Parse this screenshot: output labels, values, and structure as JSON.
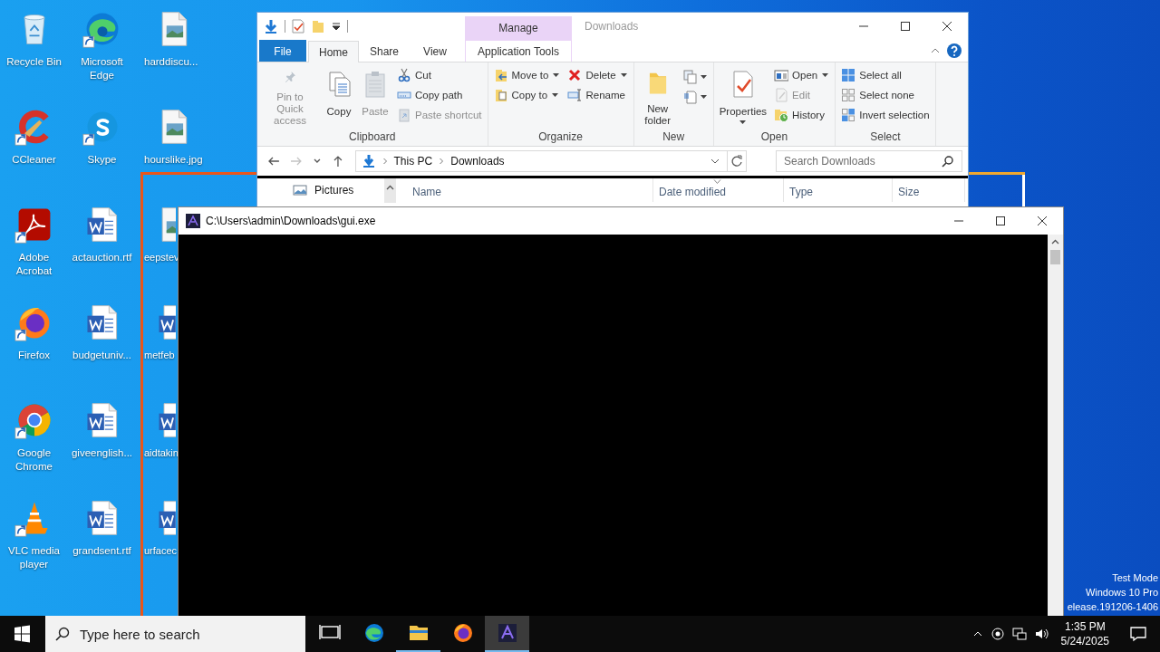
{
  "desktop": {
    "icons": [
      {
        "label": "Recycle Bin",
        "kind": "recycle",
        "shortcut": false
      },
      {
        "label": "CCleaner",
        "kind": "ccleaner",
        "shortcut": true
      },
      {
        "label": "Adobe Acrobat",
        "kind": "acrobat",
        "shortcut": true
      },
      {
        "label": "Firefox",
        "kind": "firefox",
        "shortcut": true
      },
      {
        "label": "Google Chrome",
        "kind": "chrome",
        "shortcut": true
      },
      {
        "label": "VLC media player",
        "kind": "vlc",
        "shortcut": true
      },
      {
        "label": "Microsoft Edge",
        "kind": "edge",
        "shortcut": true
      },
      {
        "label": "Skype",
        "kind": "skype",
        "shortcut": true
      },
      {
        "label": "actauction.rtf",
        "kind": "word",
        "shortcut": false
      },
      {
        "label": "budgetuniv...",
        "kind": "word",
        "shortcut": false
      },
      {
        "label": "giveenglish...",
        "kind": "word",
        "shortcut": false
      },
      {
        "label": "grandsent.rtf",
        "kind": "word",
        "shortcut": false
      },
      {
        "label": "harddiscu...",
        "kind": "image",
        "shortcut": false
      },
      {
        "label": "hourslike.jpg",
        "kind": "image",
        "shortcut": false
      },
      {
        "label": "eepstev",
        "kind": "image",
        "shortcut": false
      },
      {
        "label": "metfeb",
        "kind": "word",
        "shortcut": false
      },
      {
        "label": "aidtakin",
        "kind": "word",
        "shortcut": false
      },
      {
        "label": "urfacec",
        "kind": "word",
        "shortcut": false
      }
    ],
    "system_text": [
      "Test Mode",
      "Windows 10 Pro",
      "elease.191206-1406"
    ]
  },
  "explorer": {
    "title": "Downloads",
    "context_tab": "Manage",
    "tabs": [
      {
        "label": "File",
        "kind": "file",
        "selected": false
      },
      {
        "label": "Home",
        "kind": "normal",
        "selected": true
      },
      {
        "label": "Share",
        "kind": "normal",
        "selected": false
      },
      {
        "label": "View",
        "kind": "normal",
        "selected": false
      },
      {
        "label": "Application Tools",
        "kind": "context",
        "selected": false
      }
    ],
    "ribbon_groups": [
      {
        "label": "Clipboard",
        "columns": [
          [
            {
              "label": "Pin to Quick access",
              "kind": "large",
              "disabled": true,
              "menu": false
            }
          ],
          [
            {
              "label": "Copy",
              "kind": "large",
              "disabled": false,
              "menu": false
            }
          ],
          [
            {
              "label": "Paste",
              "kind": "large",
              "disabled": true,
              "menu": false
            }
          ],
          [
            {
              "label": "Cut",
              "kind": "small",
              "disabled": false,
              "menu": false
            },
            {
              "label": "Copy path",
              "kind": "small",
              "disabled": false,
              "menu": false
            },
            {
              "label": "Paste shortcut",
              "kind": "small",
              "disabled": true,
              "menu": false
            }
          ]
        ]
      },
      {
        "label": "Organize",
        "columns": [
          [
            {
              "label": "Move to",
              "kind": "small",
              "disabled": false,
              "menu": true
            },
            {
              "label": "Copy to",
              "kind": "small",
              "disabled": false,
              "menu": true
            }
          ],
          [
            {
              "label": "Delete",
              "kind": "small",
              "disabled": false,
              "menu": true
            },
            {
              "label": "Rename",
              "kind": "small",
              "disabled": false,
              "menu": false
            }
          ]
        ]
      },
      {
        "label": "New",
        "columns": [
          [
            {
              "label": "New folder",
              "kind": "large",
              "disabled": false,
              "menu": false
            }
          ],
          [
            {
              "kind": "icon",
              "disabled": false,
              "menu": true
            },
            {
              "kind": "icon",
              "disabled": false,
              "menu": true
            }
          ]
        ]
      },
      {
        "label": "Open",
        "columns": [
          [
            {
              "label": "Properties",
              "kind": "large",
              "disabled": false,
              "menu": true
            }
          ],
          [
            {
              "label": "Open",
              "kind": "small",
              "disabled": false,
              "menu": true
            },
            {
              "label": "Edit",
              "kind": "small",
              "disabled": true,
              "menu": false
            },
            {
              "label": "History",
              "kind": "small",
              "disabled": false,
              "menu": false
            }
          ]
        ]
      },
      {
        "label": "Select",
        "columns": [
          [
            {
              "label": "Select all",
              "kind": "small",
              "disabled": false,
              "menu": false
            },
            {
              "label": "Select none",
              "kind": "small",
              "disabled": false,
              "menu": false
            },
            {
              "label": "Invert selection",
              "kind": "small",
              "disabled": false,
              "menu": false
            }
          ]
        ]
      }
    ],
    "nav_buttons": [
      {
        "kind": "back",
        "disabled": false
      },
      {
        "kind": "forward",
        "disabled": true
      },
      {
        "kind": "recent",
        "disabled": false
      },
      {
        "kind": "up",
        "disabled": false
      }
    ],
    "path": [
      "This PC",
      "Downloads"
    ],
    "search": {
      "placeholder": "Search Downloads"
    },
    "nav_pane": [
      {
        "label": "Pictures"
      }
    ],
    "columns": [
      {
        "label": "Name",
        "sorted": false
      },
      {
        "label": "Date modified",
        "sorted": true
      },
      {
        "label": "Type",
        "sorted": false
      },
      {
        "label": "Size",
        "sorted": false
      }
    ]
  },
  "console": {
    "title": "C:\\Users\\admin\\Downloads\\gui.exe"
  },
  "taskbar": {
    "search": {
      "placeholder": "Type here to search"
    },
    "apps": [
      {
        "kind": "taskview",
        "running": false,
        "selected": false
      },
      {
        "kind": "edge",
        "running": false,
        "selected": false
      },
      {
        "kind": "explorer",
        "running": true,
        "selected": false
      },
      {
        "kind": "firefox",
        "running": false,
        "selected": false
      },
      {
        "kind": "app",
        "running": true,
        "selected": true
      }
    ],
    "time": "1:35 PM",
    "date": "5/24/2025"
  }
}
